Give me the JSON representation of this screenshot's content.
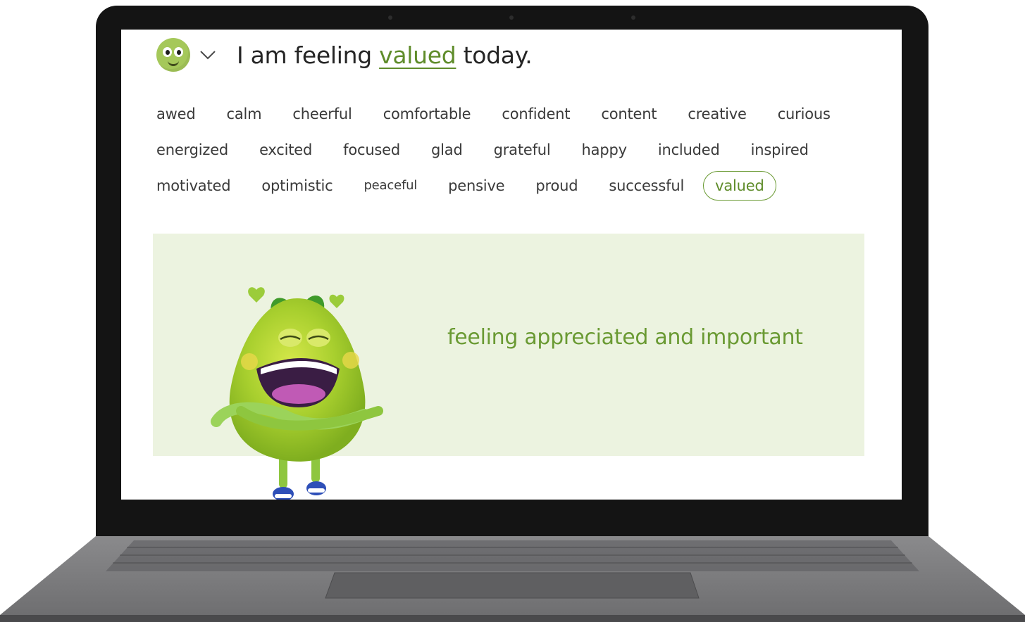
{
  "header": {
    "prefix": "I am feeling",
    "selected_emotion": "valued",
    "suffix": "today."
  },
  "emotions": [
    [
      "awed",
      "calm",
      "cheerful",
      "comfortable",
      "confident",
      "content",
      "creative",
      "curious"
    ],
    [
      "energized",
      "excited",
      "focused",
      "glad",
      "grateful",
      "happy",
      "included",
      "inspired"
    ],
    [
      "motivated",
      "optimistic",
      "peaceful",
      "pensive",
      "proud",
      "successful",
      "valued"
    ]
  ],
  "definition": "feeling appreciated and important",
  "colors": {
    "accent": "#6a9a33",
    "panel_bg": "#ecf3e0",
    "mood_face": "#a5c85a"
  },
  "icons": {
    "mood": "smiley-face-icon",
    "dropdown": "chevron-down-icon"
  }
}
